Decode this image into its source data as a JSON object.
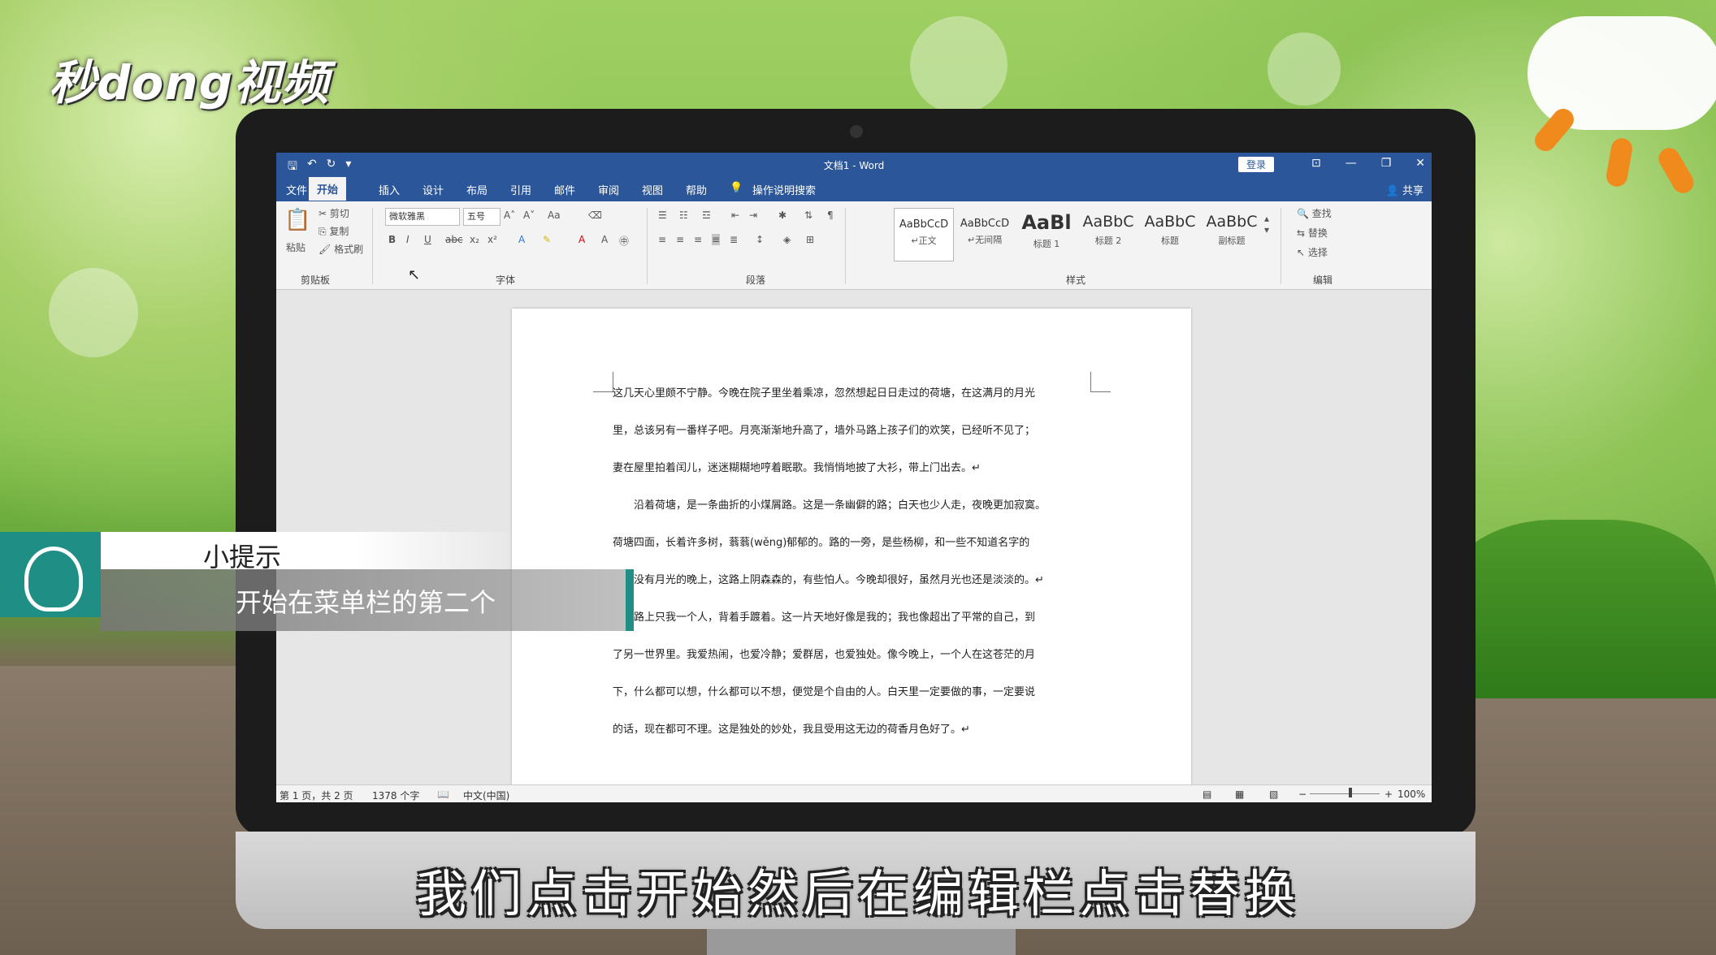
{
  "brand": {
    "logo_text": "秒dong视频"
  },
  "word": {
    "title": "文档1 - Word",
    "login_label": "登录",
    "qat": {
      "save": "🖫",
      "undo": "↶",
      "redo": "↻",
      "more": "▾"
    },
    "window_buttons": {
      "ribbon_options": "⊡",
      "minimize": "—",
      "restore": "❐",
      "close": "✕"
    },
    "tabs": [
      "文件",
      "开始",
      "插入",
      "设计",
      "布局",
      "引用",
      "邮件",
      "审阅",
      "视图",
      "帮助"
    ],
    "search_label": "操作说明搜索",
    "share_label": "共享",
    "ribbon": {
      "clipboard": {
        "paste": "粘贴",
        "cut": "剪切",
        "copy": "复制",
        "format_painter": "格式刷",
        "label": "剪贴板"
      },
      "font": {
        "font_name": "微软雅黑",
        "font_size": "五号",
        "label": "字体"
      },
      "paragraph": {
        "label": "段落"
      },
      "styles": {
        "label": "样式",
        "items": [
          {
            "preview": "AaBbCcD",
            "name": "↵正文"
          },
          {
            "preview": "AaBbCcD",
            "name": "↵无间隔"
          },
          {
            "preview": "AaBl",
            "name": "标题 1"
          },
          {
            "preview": "AaBbC",
            "name": "标题 2"
          },
          {
            "preview": "AaBbC",
            "name": "标题"
          },
          {
            "preview": "AaBbC",
            "name": "副标题"
          }
        ]
      },
      "editing": {
        "find": "查找",
        "replace": "替换",
        "select": "选择",
        "label": "编辑"
      }
    },
    "document": {
      "lines": [
        "这几天心里颇不宁静。今晚在院子里坐着乘凉，忽然想起日日走过的荷塘，在这满月的月光",
        "里，总该另有一番样子吧。月亮渐渐地升高了，墙外马路上孩子们的欢笑，已经听不见了；",
        "妻在屋里拍着闰儿，迷迷糊糊地哼着眠歌。我悄悄地披了大衫，带上门出去。↵",
        "　　沿着荷塘，是一条曲折的小煤屑路。这是一条幽僻的路；白天也少人走，夜晚更加寂寞。",
        "荷塘四面，长着许多树，蓊蓊(wěng)郁郁的。路的一旁，是些杨柳，和一些不知道名字的",
        "　　没有月光的晚上，这路上阴森森的，有些怕人。今晚却很好，虽然月光也还是淡淡的。↵",
        "　　路上只我一个人，背着手踱着。这一片天地好像是我的；我也像超出了平常的自己，到",
        "了另一世界里。我爱热闹，也爱冷静；爱群居，也爱独处。像今晚上，一个人在这苍茫的月",
        "下，什么都可以想，什么都可以不想，便觉是个自由的人。白天里一定要做的事，一定要说",
        "的话，现在都可不理。这是独处的妙处，我且受用这无边的荷香月色好了。↵"
      ]
    },
    "status": {
      "page": "第 1 页，共 2 页",
      "words": "1378 个字",
      "language": "中文(中国)",
      "zoom": "100%"
    }
  },
  "tip": {
    "title": "小提示",
    "text": "开始在菜单栏的第二个"
  },
  "subtitle": "我们点击开始然后在编辑栏点击替换"
}
